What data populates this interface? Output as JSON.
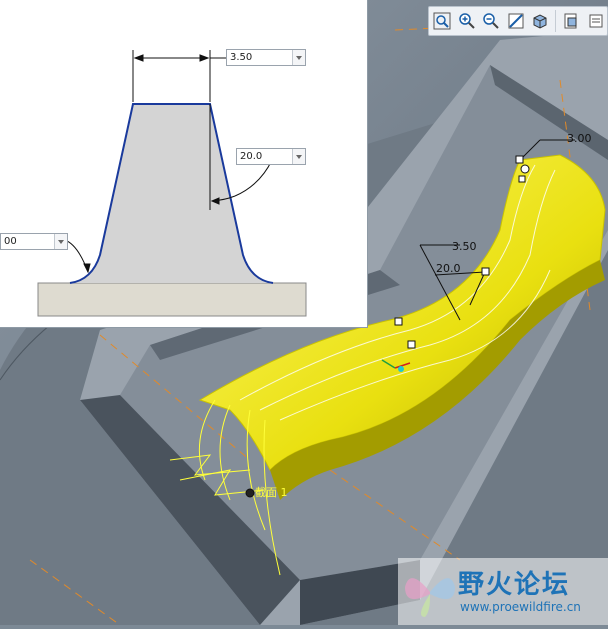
{
  "toolbar": {
    "buttons": [
      {
        "name": "zoom-fit-icon"
      },
      {
        "name": "zoom-in-icon"
      },
      {
        "name": "zoom-out-icon"
      },
      {
        "name": "repaint-icon"
      },
      {
        "name": "display-style-icon"
      },
      {
        "name": "saved-views-icon"
      },
      {
        "name": "layers-icon"
      }
    ]
  },
  "inset": {
    "top_width": "3.50",
    "draft_angle": "20.0",
    "fillet_radius": "00"
  },
  "viewport": {
    "dim_width": "3.50",
    "dim_angle": "20.0",
    "dim_top": "3.00",
    "section_label": "截面 1"
  },
  "watermark": {
    "title": "野火论坛",
    "url": "www.proewildfire.cn"
  },
  "colors": {
    "rib": "#f0ea12",
    "rib_shadow": "#b8b000",
    "profile_edge": "#1a3a9c",
    "part": "#6b7682"
  }
}
